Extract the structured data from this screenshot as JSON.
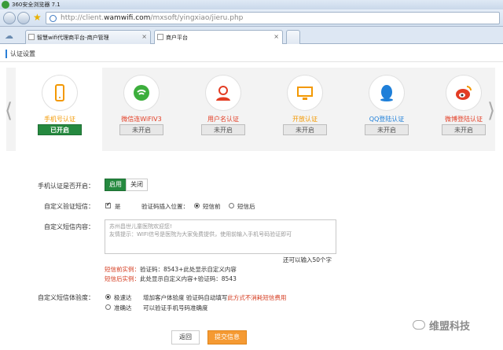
{
  "browser": {
    "title": "360安全浏览器 7.1",
    "url_prefix": "http://client.",
    "url_domain": "wamwifi.com",
    "url_path": "/mxsoft/yingxiao/jieru.php",
    "tabs": [
      {
        "label": "智慧wifi代理商平台-商户管理"
      },
      {
        "label": "商户平台"
      }
    ]
  },
  "page": {
    "section_title": "认证设置"
  },
  "auth_methods": [
    {
      "label": "手机号认证",
      "button": "已开启",
      "enabled": true,
      "color": "#f39800"
    },
    {
      "label": "微信连WiFIV3",
      "button": "未开启",
      "enabled": false,
      "color": "#e33c23"
    },
    {
      "label": "用户名认证",
      "button": "未开启",
      "enabled": false,
      "color": "#e33c23"
    },
    {
      "label": "开放认证",
      "button": "未开启",
      "enabled": false,
      "color": "#f39800"
    },
    {
      "label": "QQ登陆认证",
      "button": "未开启",
      "enabled": false,
      "color": "#1e7fd9"
    },
    {
      "label": "微博登陆认证",
      "button": "未开启",
      "enabled": false,
      "color": "#e33c23"
    }
  ],
  "form": {
    "phone_auth_label": "手机认证是否开启：",
    "enable_label": "启用",
    "disable_label": "关闭",
    "custom_sms_label": "自定义验证短信：",
    "custom_sms_yes": "是",
    "code_position_label": "验证码插入位置：",
    "pos_before": "短信前",
    "pos_after": "短信后",
    "sms_content_label": "自定义短信内容：",
    "sms_line1": "苏州昌世儿童医院欢迎您!",
    "sms_line2": "友情提示：WIFI信号是医院为大家免费提供，使用前输入手机号码验证即可",
    "remaining": "还可以输入50个字",
    "example1_prefix": "短信前实例：",
    "example1_body": "验证码：8543+此处显示自定义内容",
    "example2_prefix": "短信后实例：",
    "example2_body": "此处显示自定义内容+验证码：8543",
    "sms_exp_label": "自定义短信体验度：",
    "opt_fast": "极速达",
    "opt_fast_desc": "增加客户体验度 验证码自动填写",
    "opt_fast_warn": "此方式不消耗短信费用",
    "opt_accurate": "准确达",
    "opt_accurate_desc": "可以验证手机号码准确度",
    "back_button": "返回",
    "submit_button": "提交信息"
  },
  "watermark": "维盟科技",
  "colors": {
    "green": "#25893f",
    "orange": "#f59a33",
    "red": "#d43b1f"
  }
}
